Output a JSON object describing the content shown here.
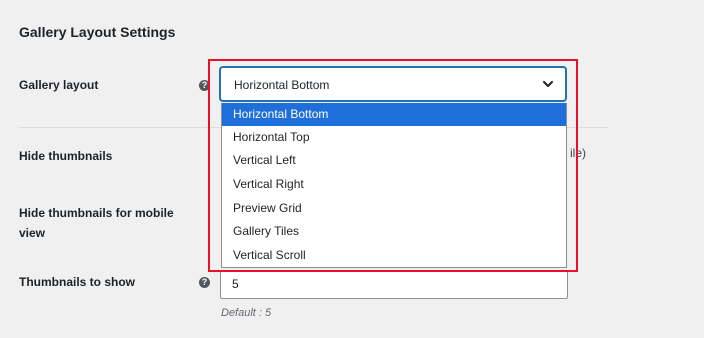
{
  "section_title": "Gallery Layout Settings",
  "help_glyph": "?",
  "fields": {
    "gallery_layout": {
      "label": "Gallery layout",
      "selected": "Horizontal Bottom",
      "options": [
        "Horizontal Bottom",
        "Horizontal Top",
        "Vertical Left",
        "Vertical Right",
        "Preview Grid",
        "Gallery Tiles",
        "Vertical Scroll"
      ]
    },
    "hide_thumbnails": {
      "label": "Hide thumbnails",
      "clipped_text": "ile)"
    },
    "hide_thumbnails_mobile": {
      "label": "Hide thumbnails for mobile view"
    },
    "thumbnails_to_show": {
      "label": "Thumbnails to show",
      "value": "5",
      "hint": "Default : 5"
    }
  },
  "colors": {
    "highlight": "#e8112d",
    "selected_option": "#1e6fd9",
    "focus": "#2271b1"
  }
}
